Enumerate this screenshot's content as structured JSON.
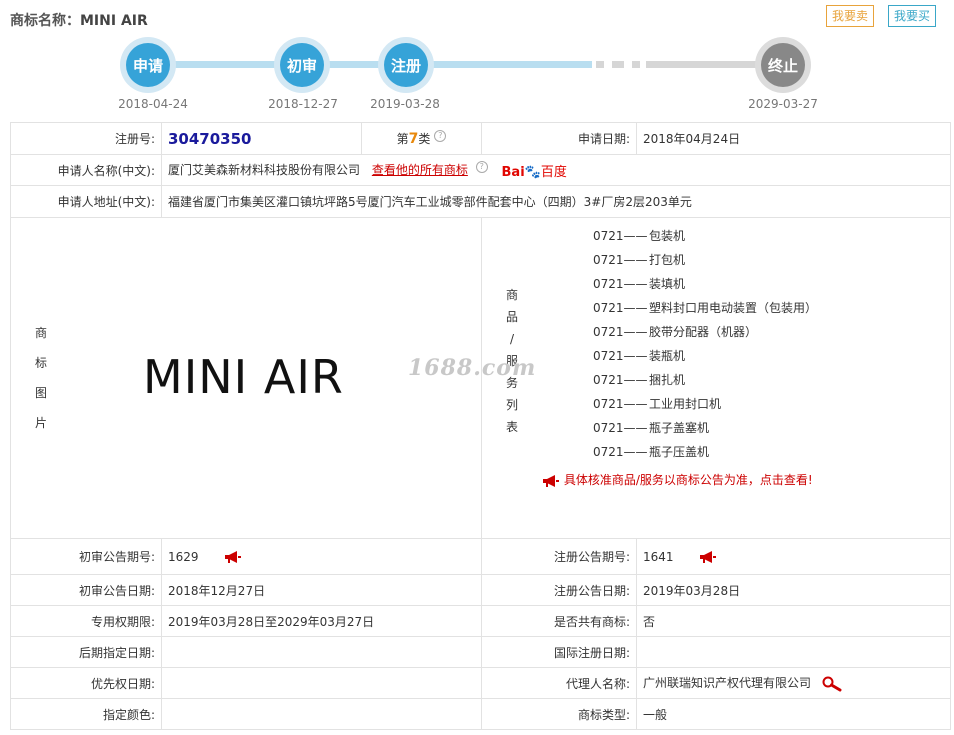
{
  "header": {
    "label": "商标名称：",
    "trademark_name": "MINI AIR",
    "sell_button": "我要卖",
    "buy_button": "我要买"
  },
  "timeline": [
    {
      "label": "申请",
      "date": "2018-04-24"
    },
    {
      "label": "初审",
      "date": "2018-12-27"
    },
    {
      "label": "注册",
      "date": "2019-03-28"
    },
    {
      "label": "终止",
      "date": "2029-03-27"
    }
  ],
  "details": {
    "reg_no_label": "注册号:",
    "reg_no": "30470350",
    "class_prefix": "第",
    "class_num": "7",
    "class_suffix": "类",
    "apply_date_label": "申请日期:",
    "apply_date": "2018年04月24日",
    "applicant_label": "申请人名称(中文):",
    "applicant": "厦门艾美森新材料科技股份有限公司",
    "applicant_link": "查看他的所有商标",
    "baidu_text": "Bai",
    "baidu_cn": "百度",
    "address_label": "申请人地址(中文):",
    "address": "福建省厦门市集美区灌口镇坑坪路5号厦门汽车工业城零部件配套中心（四期）3#厂房2层203单元",
    "image_label_chars": [
      "商",
      "标",
      "图",
      "片"
    ],
    "image_text": "MINI AIR",
    "watermark": "1688.com",
    "goods_label_chars": [
      "商",
      "品",
      "/",
      "服",
      "务",
      "列",
      "表"
    ],
    "goods": [
      {
        "code": "0721——",
        "name": "包装机"
      },
      {
        "code": "0721——",
        "name": "打包机"
      },
      {
        "code": "0721——",
        "name": "装填机"
      },
      {
        "code": "0721——",
        "name": "塑料封口用电动装置（包装用）"
      },
      {
        "code": "0721——",
        "name": "胶带分配器（机器）"
      },
      {
        "code": "0721——",
        "name": "装瓶机"
      },
      {
        "code": "0721——",
        "name": "捆扎机"
      },
      {
        "code": "0721——",
        "name": "工业用封口机"
      },
      {
        "code": "0721——",
        "name": "瓶子盖塞机"
      },
      {
        "code": "0721——",
        "name": "瓶子压盖机"
      }
    ],
    "goods_notice": "具体核准商品/服务以商标公告为准，点击查看!",
    "prelim_issue_label": "初审公告期号:",
    "prelim_issue": "1629",
    "reg_issue_label": "注册公告期号:",
    "reg_issue": "1641",
    "prelim_date_label": "初审公告日期:",
    "prelim_date": "2018年12月27日",
    "reg_pub_date_label": "注册公告日期:",
    "reg_pub_date": "2019年03月28日",
    "exclusive_label": "专用权期限:",
    "exclusive": "2019年03月28日至2029年03月27日",
    "shared_label": "是否共有商标:",
    "shared": "否",
    "later_label": "后期指定日期:",
    "later": "",
    "intl_label": "国际注册日期:",
    "intl": "",
    "priority_label": "优先权日期:",
    "priority": "",
    "agent_label": "代理人名称:",
    "agent": "广州联瑞知识产权代理有限公司",
    "color_label": "指定颜色:",
    "color": "",
    "type_label": "商标类型:",
    "type": "一般"
  },
  "colors": {
    "accent_blue": "#36a3d8",
    "sell_orange": "#e8a33b",
    "buy_teal": "#3aa7c8",
    "link_red": "#cc0000",
    "reg_no_blue": "#1a1a9c"
  }
}
